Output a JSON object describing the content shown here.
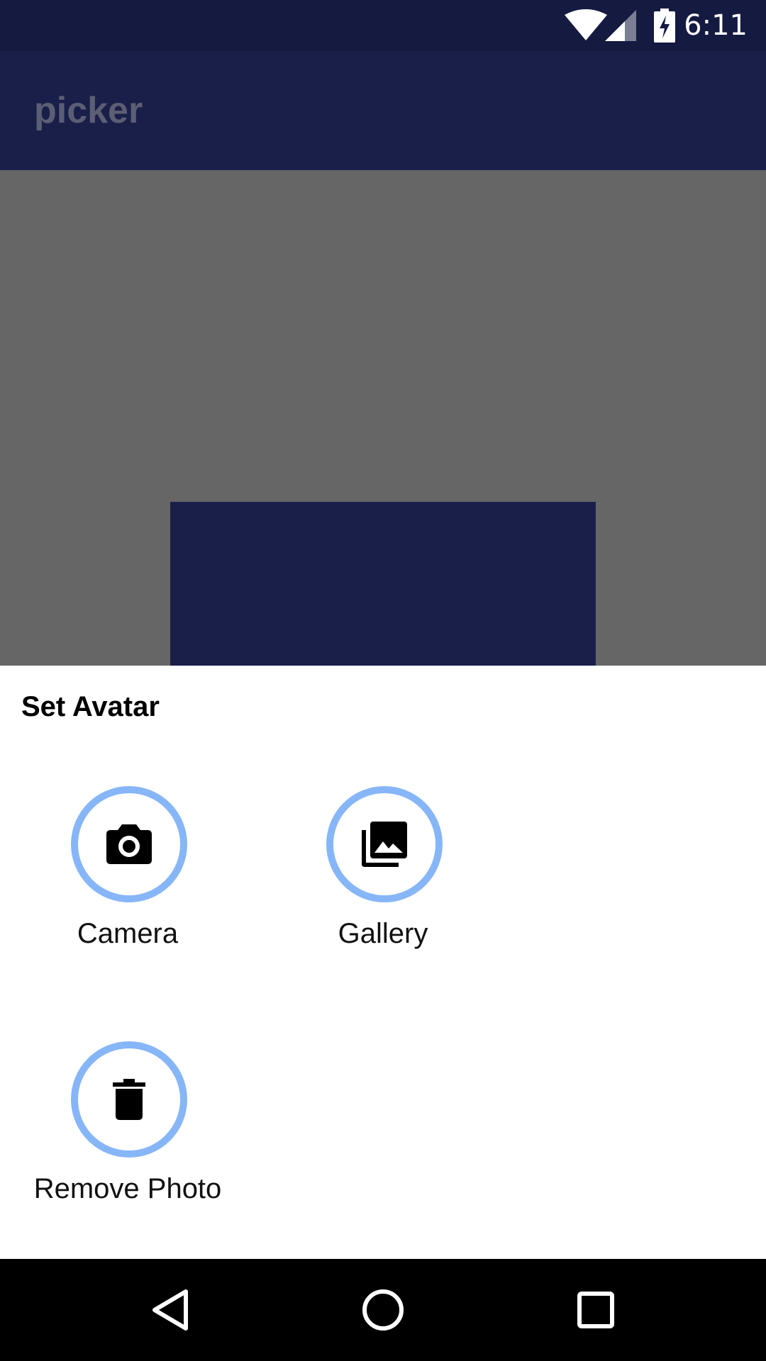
{
  "status_bar": {
    "time": "6:11",
    "icons": [
      "wifi-icon",
      "cell-signal-icon",
      "battery-charging-icon"
    ]
  },
  "app_bar": {
    "title": "picker"
  },
  "bottom_sheet": {
    "title": "Set Avatar",
    "options": [
      {
        "label": "Camera",
        "icon": "camera-icon"
      },
      {
        "label": "Gallery",
        "icon": "photo-library-icon"
      },
      {
        "label": "Remove Photo",
        "icon": "trash-icon"
      }
    ]
  },
  "nav_bar": {
    "buttons": [
      "back-icon",
      "home-icon",
      "recents-icon"
    ]
  },
  "colors": {
    "status_bar": "#141a40",
    "app_bar": "#1a1f4a",
    "scrim": "#666666",
    "sheet": "#ffffff",
    "option_ring": "#87b6f8",
    "nav_bar": "#000000"
  }
}
